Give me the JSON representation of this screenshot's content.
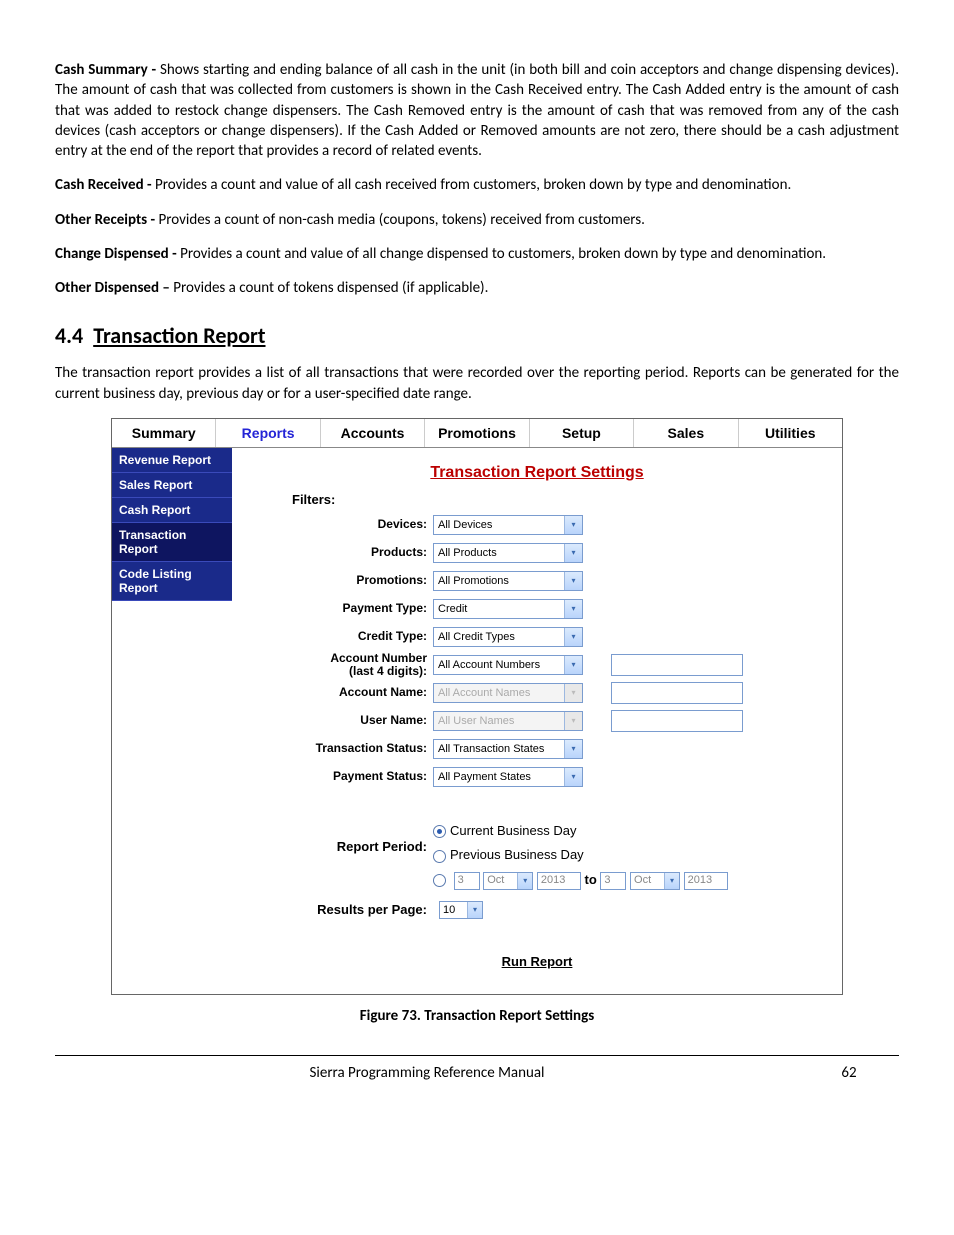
{
  "paragraphs": {
    "cash_summary": {
      "term": "Cash Summary - ",
      "text": "Shows starting and ending balance of all cash in the unit (in both bill and coin acceptors and change dispensing devices). The amount of cash that was collected from customers is shown in the Cash Received entry. The Cash Added entry is the amount of cash that was added to restock change dispensers. The Cash Removed entry is the amount of cash that was removed from any of the cash devices (cash acceptors or change dispensers). If the Cash Added or Removed amounts are not zero, there should be a cash adjustment entry at the end of the report that provides a record of related events."
    },
    "cash_received": {
      "term": "Cash Received - ",
      "text": "Provides a count and value of all cash received from customers, broken down by type and denomination."
    },
    "other_receipts": {
      "term": "Other Receipts - ",
      "text": "Provides a count of non-cash media (coupons, tokens) received from customers."
    },
    "change_dispensed": {
      "term": "Change Dispensed - ",
      "text": "Provides a count and value of all change dispensed to customers, broken down by type and denomination."
    },
    "other_dispensed": {
      "term": "Other Dispensed – ",
      "text": "Provides a count of tokens dispensed (if applicable)."
    }
  },
  "section": {
    "number": "4.4",
    "title": "Transaction Report",
    "intro": "The transaction report provides a list of all transactions that were recorded over the reporting period. Reports can be generated for the current business day, previous day or for a user-specified date range."
  },
  "figure": {
    "tabs": [
      "Summary",
      "Reports",
      "Accounts",
      "Promotions",
      "Setup",
      "Sales",
      "Utilities"
    ],
    "active_tab": "Reports",
    "sidebar": [
      "Revenue Report",
      "Sales Report",
      "Cash Report",
      "Transaction Report",
      "Code Listing Report"
    ],
    "sidebar_selected": "Transaction Report",
    "main_title": "Transaction Report Settings",
    "filters_label": "Filters:",
    "filters": {
      "devices": {
        "label": "Devices:",
        "value": "All Devices"
      },
      "products": {
        "label": "Products:",
        "value": "All Products"
      },
      "promotions": {
        "label": "Promotions:",
        "value": "All Promotions"
      },
      "payment": {
        "label": "Payment Type:",
        "value": "Credit"
      },
      "credit": {
        "label": "Credit Type:",
        "value": "All Credit Types"
      },
      "acctnum": {
        "label": "Account Number (last 4 digits):",
        "value": "All Account Numbers",
        "has_text": true
      },
      "acctname": {
        "label": "Account Name:",
        "value": "All Account Names",
        "disabled": true,
        "has_text": true
      },
      "username": {
        "label": "User Name:",
        "value": "All User Names",
        "disabled": true,
        "has_text": true
      },
      "txstatus": {
        "label": "Transaction Status:",
        "value": "All Transaction States"
      },
      "paystatus": {
        "label": "Payment Status:",
        "value": "All Payment States"
      }
    },
    "period": {
      "label": "Report Period:",
      "current": "Current Business Day",
      "previous": "Previous Business Day",
      "from": {
        "day": "3",
        "month": "Oct",
        "year": "2013"
      },
      "sep": "to",
      "to": {
        "day": "3",
        "month": "Oct",
        "year": "2013"
      }
    },
    "results": {
      "label": "Results per Page:",
      "value": "10"
    },
    "run_label": "Run Report",
    "caption": "Figure 73. Transaction Report Settings"
  },
  "footer": {
    "title": "Sierra Programming Reference Manual",
    "page": "62"
  }
}
